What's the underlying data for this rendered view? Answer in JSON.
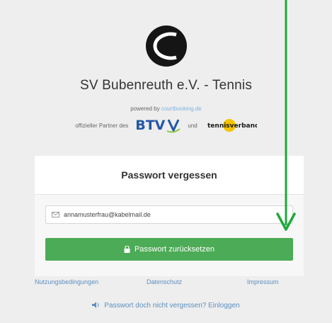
{
  "club": {
    "title": "SV Bubenreuth e.V. - Tennis",
    "powered_prefix": "powered by ",
    "powered_link": "courtbooking.de",
    "partner_prefix": "offizieller Partner des",
    "btv_logo_text": "BTV",
    "partner_and": "und",
    "tennisverband_logo_text": "tennisverband"
  },
  "form": {
    "title": "Passwort vergessen",
    "email_value": "annamusterfrau@kabelmail.de",
    "submit_label": "Passwort zurücksetzen"
  },
  "footer": {
    "links": [
      "Nutzungsbedingungen",
      "Datenschutz",
      "Impressum"
    ],
    "login_label": "Passwort doch nicht vergessen? Einloggen"
  },
  "colors": {
    "accent_green": "#4cab56",
    "link_blue": "#5d8fbf",
    "annotation_arrow": "#1ea83c"
  },
  "icons": {
    "logo": "tennis-ball-logo",
    "email": "envelope-icon",
    "submit": "lock-icon",
    "login": "speaker-icon",
    "annotation": "arrow-down-annotation"
  }
}
